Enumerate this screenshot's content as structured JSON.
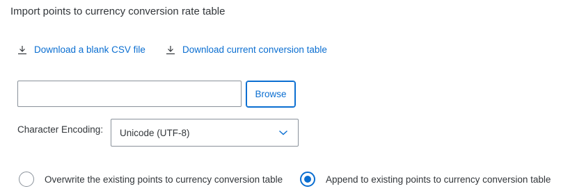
{
  "header": {
    "title": "Import points to currency conversion rate table"
  },
  "downloads": {
    "blank_csv_label": "Download a blank CSV file",
    "blank_csv_icon": "download-icon",
    "current_table_label": "Download current conversion table",
    "current_table_icon": "download-icon"
  },
  "file_upload": {
    "value": "",
    "placeholder": "",
    "browse_label": "Browse"
  },
  "encoding": {
    "label": "Character Encoding:",
    "selected": "Unicode (UTF-8)",
    "icon": "chevron-down-icon"
  },
  "import_mode": {
    "overwrite_label": "Overwrite the existing points to currency conversion table",
    "overwrite_selected": false,
    "append_label": "Append to existing points to currency conversion table",
    "append_selected": true
  },
  "colors": {
    "accent": "#0a6ed1",
    "text": "#32363a",
    "border": "#89919a"
  }
}
